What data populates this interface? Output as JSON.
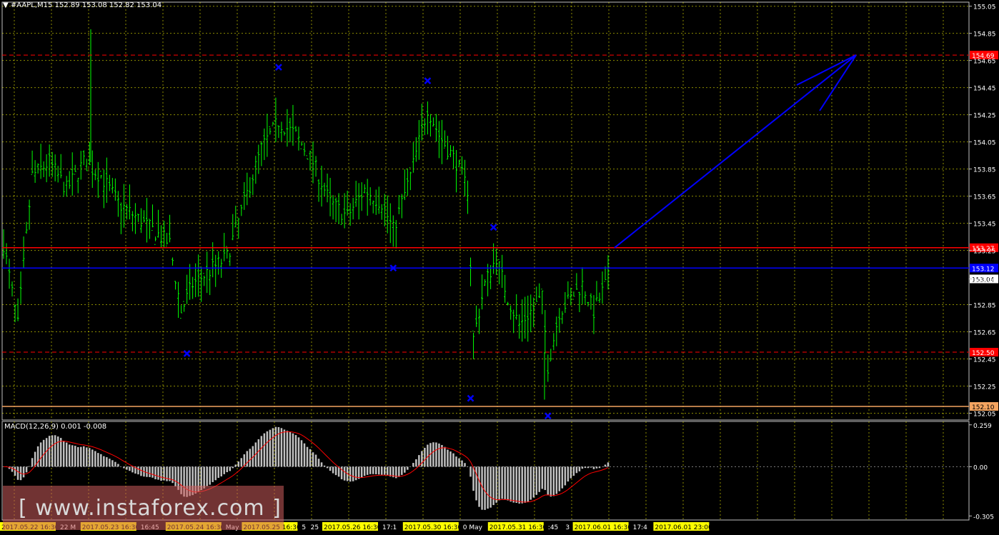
{
  "header": {
    "symbol": "#AAPL,M15",
    "ohlc": "152.89 153.08 152.82 153.04",
    "dropdown_arrow": "▼"
  },
  "price_axis": {
    "ticks": [
      "155.05",
      "154.85",
      "154.65",
      "154.45",
      "154.25",
      "154.05",
      "153.85",
      "153.65",
      "153.45",
      "153.25",
      "153.04",
      "152.85",
      "152.65",
      "152.45",
      "152.25",
      "152.05"
    ],
    "min": 152.0,
    "max": 155.08
  },
  "levels": [
    {
      "label": "154.69",
      "price": 154.69,
      "color": "#ff0000",
      "style": "dashed"
    },
    {
      "label": "153.27",
      "price": 153.27,
      "color": "#ff0000",
      "style": "solid"
    },
    {
      "label": "153.12",
      "price": 153.12,
      "color": "#0000ff",
      "style": "solid"
    },
    {
      "label": "152.50",
      "price": 152.5,
      "color": "#ff0000",
      "style": "dashed"
    },
    {
      "label": "152.10",
      "price": 152.1,
      "color": "#f4a460",
      "style": "solid"
    }
  ],
  "current_price": "153.04",
  "macd": {
    "label": "MACD(12,26,9) 0.001 -0.008",
    "ticks": [
      "0.259",
      "0.00",
      "-0.305"
    ],
    "min": -0.33,
    "max": 0.28
  },
  "time_axis": {
    "labels": [
      {
        "text": "2017.05.22 16:30",
        "highlight": true
      },
      {
        "text": "22 M",
        "highlight": false
      },
      {
        "text": "2017.05.23 16:30",
        "highlight": true
      },
      {
        "text": "16:45",
        "highlight": false
      },
      {
        "text": "2017.05.24 16:30",
        "highlight": true
      },
      {
        "text": "May",
        "highlight": false
      },
      {
        "text": "2017.05.25 16:30",
        "highlight": true
      },
      {
        "text": "5",
        "highlight": false
      },
      {
        "text": "25",
        "highlight": false
      },
      {
        "text": "2017.05.26 16:30",
        "highlight": true
      },
      {
        "text": "17:1",
        "highlight": false
      },
      {
        "text": "2017.05.30 16:30",
        "highlight": true
      },
      {
        "text": "0 May",
        "highlight": false
      },
      {
        "text": "2017.05.31 16:30",
        "highlight": true
      },
      {
        "text": ":45",
        "highlight": false
      },
      {
        "text": "3",
        "highlight": false
      },
      {
        "text": "2017.06.01 16:30",
        "highlight": true
      },
      {
        "text": "17:4",
        "highlight": false
      },
      {
        "text": "2017.06.01 23:00",
        "highlight": true
      }
    ]
  },
  "watermark": {
    "text": "[ www.instaforex.com ]"
  },
  "colors": {
    "candle": "#00ff00",
    "grid": "#ffff00",
    "macd_hist": "#c0c0c0",
    "macd_signal": "#ff0000",
    "markers": "#0000ff",
    "arrow": "#0000ff",
    "tag_highlight": "#ffff00"
  },
  "markers": [
    {
      "bar": 96,
      "price": 154.6
    },
    {
      "bar": 148,
      "price": 154.5
    },
    {
      "bar": 64,
      "price": 152.49
    },
    {
      "bar": 136,
      "price": 153.12
    },
    {
      "bar": 163,
      "price": 152.16
    },
    {
      "bar": 171,
      "price": 153.42
    },
    {
      "bar": 190,
      "price": 152.03
    }
  ]
}
